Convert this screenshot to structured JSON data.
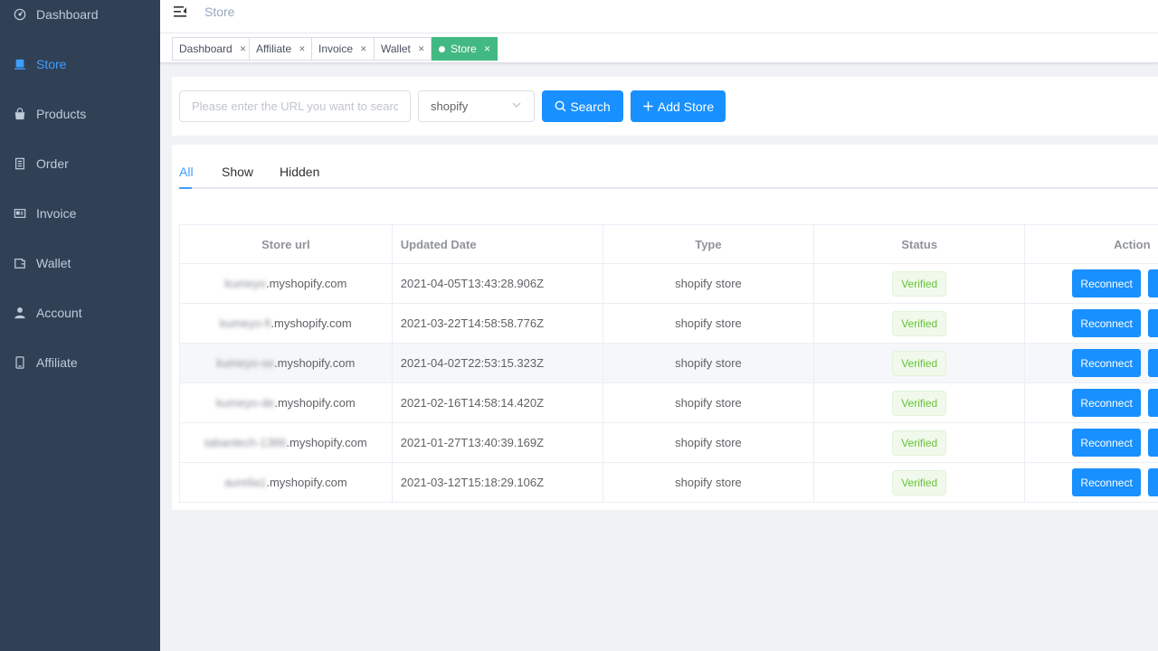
{
  "sidebar": {
    "items": [
      {
        "label": "Dashboard",
        "icon": "dashboard-icon"
      },
      {
        "label": "Store",
        "icon": "store-icon",
        "active": true
      },
      {
        "label": "Products",
        "icon": "shopping-bag-icon"
      },
      {
        "label": "Order",
        "icon": "document-icon"
      },
      {
        "label": "Invoice",
        "icon": "invoice-icon"
      },
      {
        "label": "Wallet",
        "icon": "wallet-icon"
      },
      {
        "label": "Account",
        "icon": "user-icon"
      },
      {
        "label": "Affiliate",
        "icon": "phone-icon"
      }
    ]
  },
  "navbar": {
    "breadcrumb": "Store"
  },
  "tags": [
    {
      "label": "Dashboard"
    },
    {
      "label": "Affiliate"
    },
    {
      "label": "Invoice"
    },
    {
      "label": "Wallet"
    },
    {
      "label": "Store",
      "active": true
    }
  ],
  "filter": {
    "search_placeholder": "Please enter the URL you want to search",
    "platform": "shopify",
    "search_label": "Search",
    "add_label": "Add Store"
  },
  "tabs": [
    {
      "label": "All",
      "active": true
    },
    {
      "label": "Show"
    },
    {
      "label": "Hidden"
    }
  ],
  "table": {
    "headers": [
      "Store url",
      "Updated Date",
      "Type",
      "Status",
      "Action"
    ],
    "rows": [
      {
        "url_prefix": "kumeyo",
        "url_suffix": ".myshopify.com",
        "date": "2021-04-05T13:43:28.906Z",
        "type": "shopify store",
        "status": "Verified",
        "action": "Reconnect"
      },
      {
        "url_prefix": "kumeyo-fi",
        "url_suffix": ".myshopify.com",
        "date": "2021-03-22T14:58:58.776Z",
        "type": "shopify store",
        "status": "Verified",
        "action": "Reconnect"
      },
      {
        "url_prefix": "kumeyo-se",
        "url_suffix": ".myshopify.com",
        "date": "2021-04-02T22:53:15.323Z",
        "type": "shopify store",
        "status": "Verified",
        "action": "Reconnect"
      },
      {
        "url_prefix": "kumeyo-de",
        "url_suffix": ".myshopify.com",
        "date": "2021-02-16T14:58:14.420Z",
        "type": "shopify store",
        "status": "Verified",
        "action": "Reconnect"
      },
      {
        "url_prefix": "tabantech-1386",
        "url_suffix": ".myshopify.com",
        "date": "2021-01-27T13:40:39.169Z",
        "type": "shopify store",
        "status": "Verified",
        "action": "Reconnect"
      },
      {
        "url_prefix": "aurelia1",
        "url_suffix": ".myshopify.com",
        "date": "2021-03-12T15:18:29.106Z",
        "type": "shopify store",
        "status": "Verified",
        "action": "Reconnect"
      }
    ]
  },
  "colors": {
    "sidebar_bg": "#304156",
    "sidebar_text": "#bfcbd9",
    "accent": "#409eff",
    "primary_button": "#1890ff",
    "active_tag": "#42b983",
    "verified": "#67c23a"
  }
}
